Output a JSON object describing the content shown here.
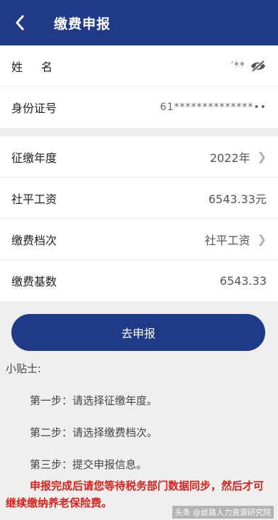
{
  "header": {
    "title": "缴费申报",
    "back_icon": "chevron-left-icon"
  },
  "identity": {
    "name_label": "姓名",
    "name_value": "′**",
    "visibility_icon": "eye-off-icon",
    "id_label": "身份证号",
    "id_value": "61**************••"
  },
  "form": {
    "year_label": "征缴年度",
    "year_value": "2022年",
    "salary_label": "社平工资",
    "salary_value": "6543.33元",
    "tier_label": "缴费档次",
    "tier_value": "社平工资",
    "base_label": "缴费基数",
    "base_value": "6543.33"
  },
  "submit_label": "去申报",
  "tips": {
    "title": "小贴士:",
    "step1": "第一步：请选择征缴年度。",
    "step2": "第二步：请选择缴费档次。",
    "step3": "第三步：提交申报信息。",
    "warning": "申报完成后请您等待税务部门数据同步，然后才可继续缴纳养老保险费。"
  },
  "watermark": "头条 @丝路人力资源研究院",
  "colors": {
    "brand": "#1f3a87",
    "warning": "#e0201b"
  }
}
